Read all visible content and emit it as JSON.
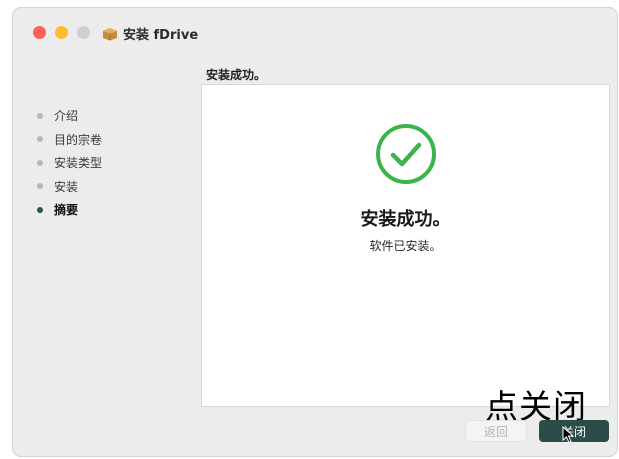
{
  "window": {
    "title": "安装 fDrive",
    "icon": "package-box-icon"
  },
  "page": {
    "step_title": "安装成功。"
  },
  "sidebar": {
    "steps": [
      {
        "label": "介绍",
        "active": false
      },
      {
        "label": "目的宗卷",
        "active": false
      },
      {
        "label": "安装类型",
        "active": false
      },
      {
        "label": "安装",
        "active": false
      },
      {
        "label": "摘要",
        "active": true
      }
    ]
  },
  "main": {
    "icon": "checkmark-circle-icon",
    "headline": "安装成功。",
    "subline": "软件已安装。"
  },
  "overlay_text": "点关闭",
  "buttons": {
    "back_label": "返回",
    "close_label": "关闭"
  },
  "colors": {
    "accent": "#2b4d4a",
    "success": "#3bb54a",
    "traffic_close": "#fe5f57",
    "traffic_minimize": "#febc2e",
    "traffic_zoom": "#cfcfcf"
  }
}
